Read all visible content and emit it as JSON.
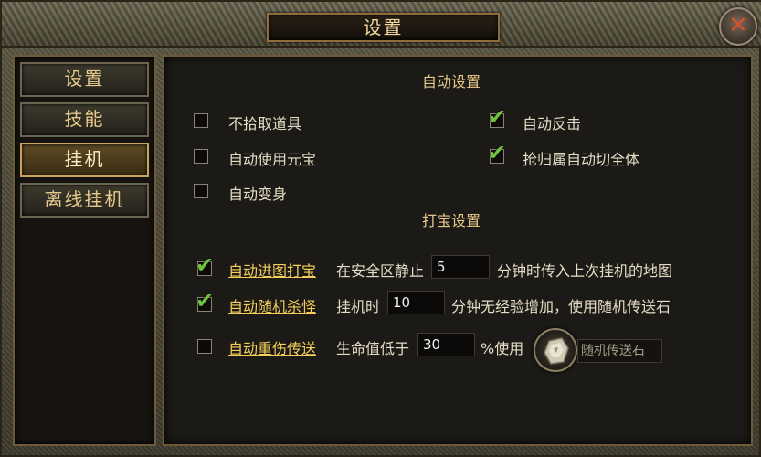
{
  "window": {
    "title": "设置"
  },
  "sidebar": {
    "items": [
      {
        "label": "设置",
        "active": false
      },
      {
        "label": "技能",
        "active": false
      },
      {
        "label": "挂机",
        "active": true
      },
      {
        "label": "离线挂机",
        "active": false
      }
    ]
  },
  "auto_settings": {
    "title": "自动设置",
    "options": [
      {
        "label": "不拾取道具",
        "checked": false
      },
      {
        "label": "自动使用元宝",
        "checked": false
      },
      {
        "label": "自动变身",
        "checked": false
      },
      {
        "label": "自动反击",
        "checked": true
      },
      {
        "label": "抢归属自动切全体",
        "checked": true
      }
    ]
  },
  "treasure_settings": {
    "title": "打宝设置",
    "rows": [
      {
        "label": "自动进图打宝",
        "checked": true,
        "prefix": "在安全区静止",
        "value": "5",
        "suffix": "分钟时传入上次挂机的地图"
      },
      {
        "label": "自动随机杀怪",
        "checked": true,
        "prefix": "挂机时",
        "value": "10",
        "suffix": "分钟无经验增加，使用随机传送石"
      },
      {
        "label": "自动重伤传送",
        "checked": false,
        "prefix": "生命值低于",
        "value": "30",
        "suffix": "%使用",
        "item_name": "随机传送石"
      }
    ]
  },
  "colors": {
    "accent": "#e8c98c",
    "link": "#f5cf5a",
    "check": "#6fc23c"
  },
  "icons": {
    "close": "close-x-icon",
    "item": "teleport-stone-icon",
    "check": "checkmark-icon"
  }
}
